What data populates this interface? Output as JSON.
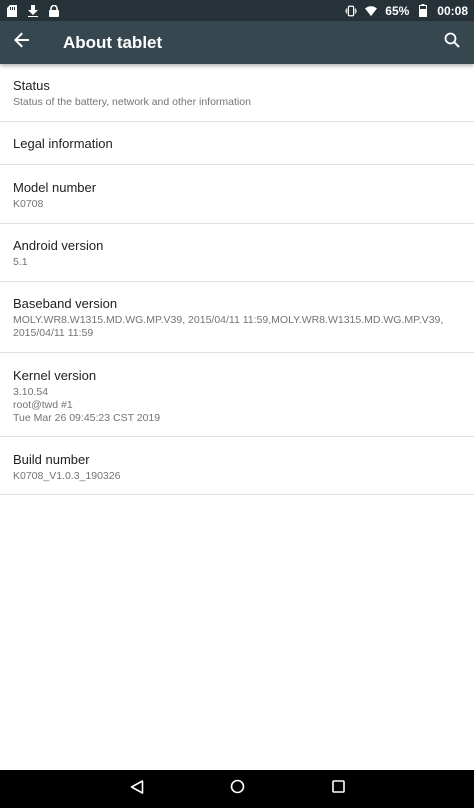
{
  "status_bar": {
    "battery_percent": "65%",
    "time": "00:08",
    "left_icons": [
      "sd-card-icon",
      "download-icon",
      "lock-icon"
    ],
    "right_icons": [
      "vibrate-icon",
      "wifi-icon",
      "battery-icon"
    ]
  },
  "app_bar": {
    "title": "About tablet",
    "back_icon": "arrow-back-icon",
    "search_icon": "search-icon"
  },
  "items": [
    {
      "title": "Status",
      "subtitle": "Status of the battery, network and other information"
    },
    {
      "title": "Legal information",
      "subtitle": ""
    },
    {
      "title": "Model number",
      "subtitle": "K0708"
    },
    {
      "title": "Android version",
      "subtitle": "5.1"
    },
    {
      "title": "Baseband version",
      "subtitle_lines": [
        "MOLY.WR8.W1315.MD.WG.MP.V39, 2015/04/11 11:59,MOLY.WR8.W1315.MD.WG.MP.V39,",
        "2015/04/11 11:59"
      ]
    },
    {
      "title": "Kernel version",
      "subtitle_lines": [
        "3.10.54",
        "root@twd #1",
        "Tue Mar 26 09:45:23 CST 2019"
      ]
    },
    {
      "title": "Build number",
      "subtitle": "K0708_V1.0.3_190326"
    }
  ],
  "nav_bar": {
    "back_icon": "nav-back-icon",
    "home_icon": "nav-home-icon",
    "recents_icon": "nav-recents-icon"
  },
  "colors": {
    "status_bar": "#263238",
    "app_bar": "#37474f",
    "divider": "#e0e0e0",
    "title_text": "#212121",
    "subtitle_text": "#737373"
  }
}
